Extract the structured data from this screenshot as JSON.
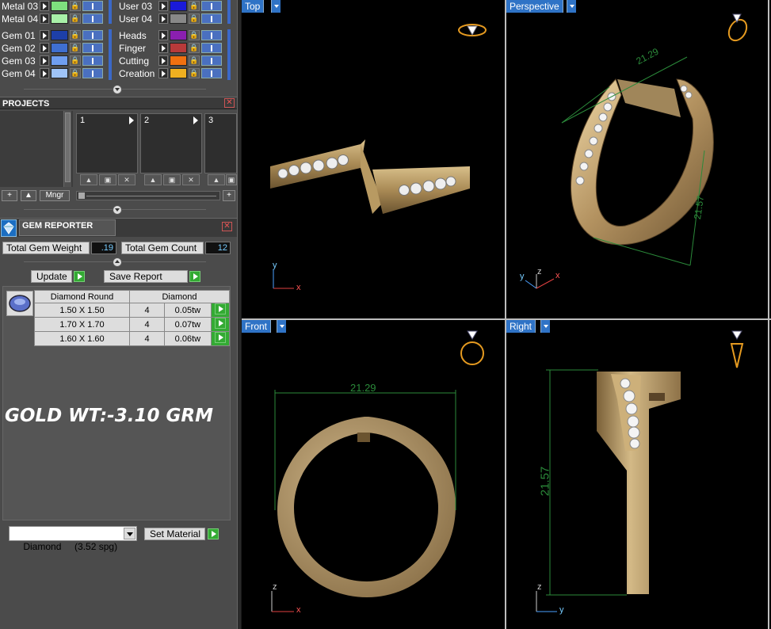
{
  "layers": {
    "left": [
      {
        "name": "Metal 03",
        "color": "#7ee07e"
      },
      {
        "name": "Metal 04",
        "color": "#a8f0a8"
      },
      {
        "name": "Gem 01",
        "color": "#1d3fa8"
      },
      {
        "name": "Gem 02",
        "color": "#3f6fd0"
      },
      {
        "name": "Gem 03",
        "color": "#6f9ef0"
      },
      {
        "name": "Gem 04",
        "color": "#9fc4f8"
      }
    ],
    "right": [
      {
        "name": "User 03",
        "color": "#1a1ad8"
      },
      {
        "name": "User 04",
        "color": "#888888"
      },
      {
        "name": "Heads",
        "color": "#8a1fb0"
      },
      {
        "name": "Finger",
        "color": "#b83a3a"
      },
      {
        "name": "Cutting",
        "color": "#f07010"
      },
      {
        "name": "Creation",
        "color": "#f0b020"
      }
    ]
  },
  "projects": {
    "title": "PROJECTS",
    "slots": [
      "1",
      "2",
      "3"
    ],
    "mngr_label": "Mngr"
  },
  "gem_reporter": {
    "title": "GEM REPORTER",
    "weight_label": "Total Gem Weight",
    "weight_value": ".19",
    "count_label": "Total Gem Count",
    "count_value": "12",
    "update_label": "Update",
    "save_label": "Save Report",
    "table_headers": [
      "Diamond Round",
      "Diamond"
    ],
    "rows": [
      {
        "size": "1.50 X 1.50",
        "count": "4",
        "tw": "0.05tw"
      },
      {
        "size": "1.70 X 1.70",
        "count": "4",
        "tw": "0.07tw"
      },
      {
        "size": "1.60 X 1.60",
        "count": "4",
        "tw": "0.06tw"
      }
    ],
    "note": "GOLD WT:-3.10 GRM",
    "material_value": "Diamond     (3.52 spg)",
    "set_material_label": "Set Material"
  },
  "viewports": {
    "top": "Top",
    "perspective": "Perspective",
    "front": "Front",
    "right": "Right"
  },
  "dimensions": {
    "width": "21.29",
    "height": "21.57"
  },
  "axes": {
    "x": "x",
    "y": "y",
    "z": "z"
  }
}
